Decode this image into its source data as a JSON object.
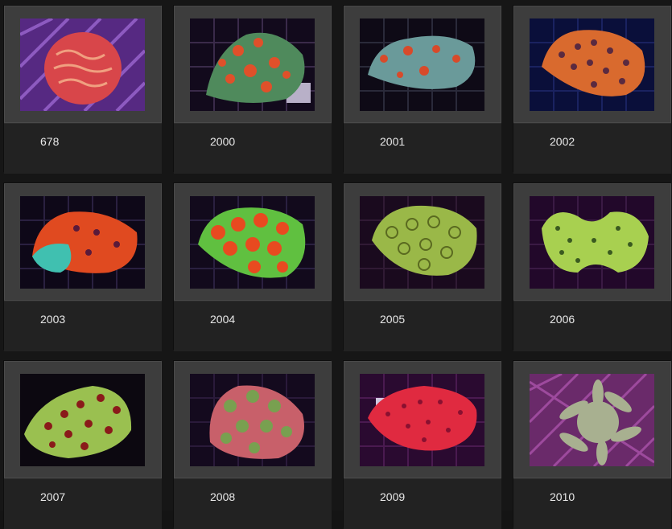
{
  "gallery": {
    "items": [
      {
        "label": "678",
        "photo_icon": "red-brain-coral-photo"
      },
      {
        "label": "2000",
        "photo_icon": "green-orange-coral-photo"
      },
      {
        "label": "2001",
        "photo_icon": "blue-green-coral-photo"
      },
      {
        "label": "2002",
        "photo_icon": "orange-coral-photo"
      },
      {
        "label": "2003",
        "photo_icon": "red-teal-coral-photo"
      },
      {
        "label": "2004",
        "photo_icon": "orange-green-coral-photo"
      },
      {
        "label": "2005",
        "photo_icon": "green-coral-photo"
      },
      {
        "label": "2006",
        "photo_icon": "lime-coral-photo"
      },
      {
        "label": "2007",
        "photo_icon": "green-red-coral-photo"
      },
      {
        "label": "2008",
        "photo_icon": "pink-green-coral-photo"
      },
      {
        "label": "2009",
        "photo_icon": "red-coral-photo"
      },
      {
        "label": "2010",
        "photo_icon": "pale-mushroom-coral-photo"
      }
    ]
  },
  "colors": {
    "page_bg": "#161616",
    "frame_bg": "#3d3d3d",
    "caption_bg": "#222222",
    "label_text": "#e8e8e8"
  }
}
